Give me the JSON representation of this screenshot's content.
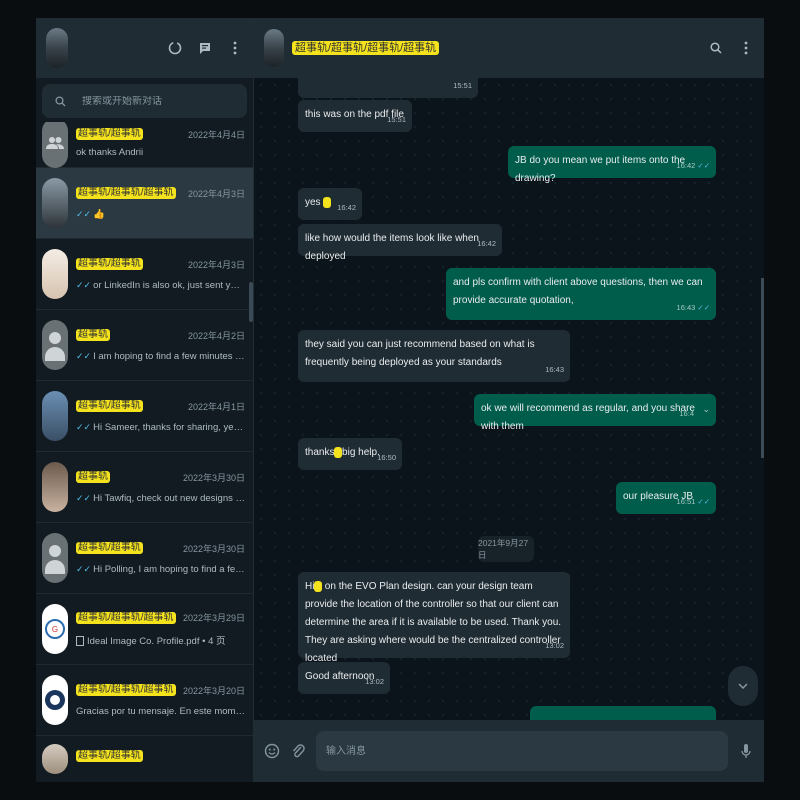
{
  "sidebar": {
    "search_placeholder": "搜索或开始新对话",
    "chats": [
      {
        "name": "超事轨/超事轨",
        "date": "2022年4月4日",
        "last": "ok thanks Andrii",
        "ticks": "",
        "avatar": "group"
      },
      {
        "name": "超事轨/超事轨/超事轨",
        "date": "2022年4月3日",
        "last": "👍",
        "ticks": "✓✓",
        "avatar": "photo1"
      },
      {
        "name": "超事轨/超事轨",
        "date": "2022年4月3日",
        "last": "or LinkedIn is also ok, just sent you connectio...",
        "ticks": "✓✓",
        "avatar": "photo2"
      },
      {
        "name": "超事轨",
        "date": "2022年4月2日",
        "last": "I am hoping to find a few minutes to connect ...",
        "ticks": "✓✓",
        "avatar": "default"
      },
      {
        "name": "超事轨/超事轨",
        "date": "2022年4月1日",
        "last": "Hi Sameer, thanks for sharing, yes I would like...",
        "ticks": "✓✓",
        "avatar": "photo3"
      },
      {
        "name": "超事轨",
        "date": "2022年3月30日",
        "last": "Hi Tawfiq, check out new designs on my websi...",
        "ticks": "✓✓",
        "avatar": "photo4"
      },
      {
        "name": "超事轨/超事轨",
        "date": "2022年3月30日",
        "last": "Hi Polling, I am hoping to find a few minutes t...",
        "ticks": "✓✓",
        "avatar": "default"
      },
      {
        "name": "超事轨/超事轨/超事轨",
        "date": "2022年3月29日",
        "last": "Ideal Image Co. Profile.pdf • 4 页",
        "ticks": "",
        "avatar": "photo5"
      },
      {
        "name": "超事轨/超事轨/超事轨",
        "date": "2022年3月20日",
        "last": "Gracias por tu mensaje. En este momento no po...",
        "ticks": "",
        "avatar": "photo6"
      },
      {
        "name": "超事轨/超事轨",
        "date": "",
        "last": "",
        "ticks": "",
        "avatar": "photo7"
      }
    ]
  },
  "conversation": {
    "name": "超事轨/超事轨/超事轨/超事轨",
    "date_chip": "2021年9月27日",
    "composer_placeholder": "输入消息",
    "messages": [
      {
        "dir": "in",
        "text": "",
        "time": "15:51"
      },
      {
        "dir": "in",
        "text": "this was on the pdf file",
        "time": "15:51"
      },
      {
        "dir": "out",
        "text": "JB do you mean we put items onto the drawing?",
        "time": "16:42"
      },
      {
        "dir": "in",
        "text": "yes",
        "time": "16:42"
      },
      {
        "dir": "in",
        "text": "like how would the items look like when deployed",
        "time": "16:42"
      },
      {
        "dir": "out",
        "text": "and pls confirm with client above questions, then we can provide accurate quotation,",
        "time": "16:43"
      },
      {
        "dir": "in",
        "text": "they said you can just recommend based on what is frequently being deployed as your standards",
        "time": "16:43"
      },
      {
        "dir": "out",
        "text": "ok we will recommend as regular, and you share with them",
        "time": "16:4"
      },
      {
        "dir": "in",
        "text_a": "thanks",
        "text_b": "big help.",
        "time": "16:50"
      },
      {
        "dir": "out",
        "text": "our pleasure JB",
        "time": "16:51"
      },
      {
        "dir": "in",
        "text_a": "Hi",
        "text_b": "on the EVO Plan design. can your design team provide the location of the controller so that our client can determine the area if it is available to be used. Thank you. They are asking where would be the centralized controller located",
        "time": "13:02"
      },
      {
        "dir": "in",
        "text": "Good afternoon",
        "time": "13:02"
      }
    ]
  }
}
